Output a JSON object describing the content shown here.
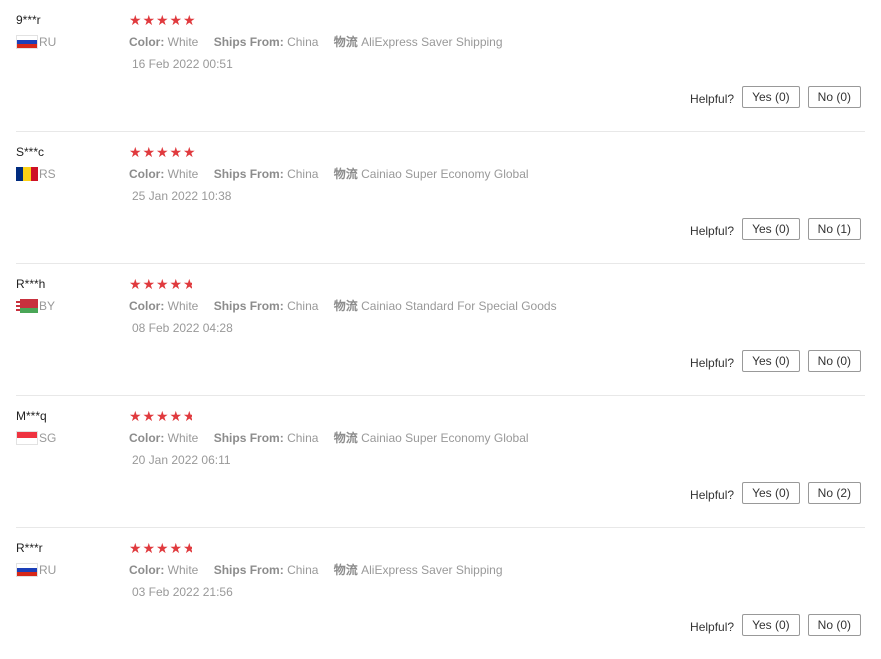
{
  "labels": {
    "color": "Color:",
    "ships_from": "Ships From:",
    "logistics": "物流",
    "helpful": "Helpful?"
  },
  "colors": {
    "star": "#e03a3e",
    "muted": "#999999",
    "divider": "#e8e8e8"
  },
  "reviews": [
    {
      "user": "9***r",
      "country": "RU",
      "flag": "russia-flag-icon",
      "rating": 5,
      "color": "White",
      "ships_from": "China",
      "logistics": "AliExpress Saver Shipping",
      "date": "16 Feb 2022 00:51",
      "yes": "Yes (0)",
      "no": "No (0)"
    },
    {
      "user": "S***c",
      "country": "RS",
      "flag": "romania-flag-icon",
      "rating": 5,
      "color": "White",
      "ships_from": "China",
      "logistics": "Cainiao Super Economy Global",
      "date": "25 Jan 2022 10:38",
      "yes": "Yes (0)",
      "no": "No (1)"
    },
    {
      "user": "R***h",
      "country": "BY",
      "flag": "belarus-flag-icon",
      "rating": 4.8,
      "color": "White",
      "ships_from": "China",
      "logistics": "Cainiao Standard For Special Goods",
      "date": "08 Feb 2022 04:28",
      "yes": "Yes (0)",
      "no": "No (0)"
    },
    {
      "user": "M***q",
      "country": "SG",
      "flag": "singapore-flag-icon",
      "rating": 4.8,
      "color": "White",
      "ships_from": "China",
      "logistics": "Cainiao Super Economy Global",
      "date": "20 Jan 2022 06:11",
      "yes": "Yes (0)",
      "no": "No (2)"
    },
    {
      "user": "R***r",
      "country": "RU",
      "flag": "russia-flag-icon",
      "rating": 4.8,
      "color": "White",
      "ships_from": "China",
      "logistics": "AliExpress Saver Shipping",
      "date": "03 Feb 2022 21:56",
      "yes": "Yes (0)",
      "no": "No (0)"
    }
  ]
}
